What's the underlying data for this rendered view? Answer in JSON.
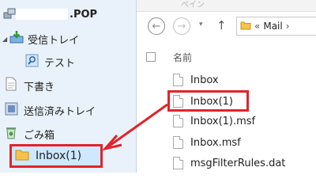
{
  "left_pane": {
    "account": {
      "label": ".POP"
    },
    "folders": [
      {
        "label": "受信トレイ"
      },
      {
        "label": "テスト"
      },
      {
        "label": "下書き"
      },
      {
        "label": "送信済みトレイ"
      },
      {
        "label": "ごみ箱"
      },
      {
        "label": "Inbox(1)"
      }
    ]
  },
  "right_pane": {
    "ribbon_text": "ペイン",
    "address": {
      "prefix": "«",
      "folder": "Mail",
      "separator": "›"
    },
    "column_header": "名前",
    "files": [
      {
        "name": "Inbox"
      },
      {
        "name": "Inbox(1)"
      },
      {
        "name": "Inbox(1).msf"
      },
      {
        "name": "Inbox.msf"
      },
      {
        "name": "msgFilterRules.dat"
      }
    ]
  },
  "colors": {
    "highlight_border": "#e2232b",
    "left_pane_bg": "#e9f2fb",
    "selected_folder_bg": "#cde8ff"
  }
}
